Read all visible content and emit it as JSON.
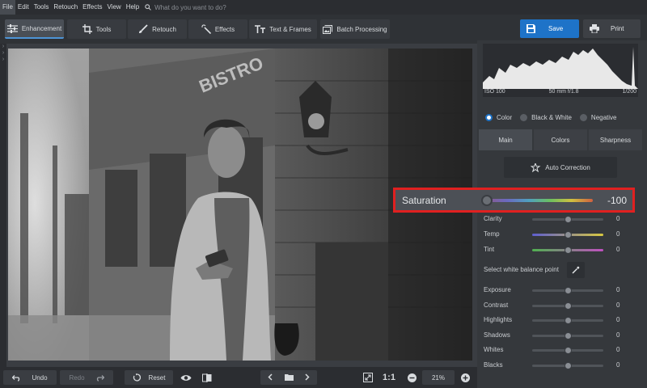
{
  "menu": {
    "items": [
      "File",
      "Edit",
      "Tools",
      "Retouch",
      "Effects",
      "View",
      "Help"
    ],
    "search_placeholder": "What do you want to do?"
  },
  "toolbar": {
    "tabs": [
      {
        "label": "Enhancement",
        "icon": "sliders-icon"
      },
      {
        "label": "Tools",
        "icon": "crop-icon"
      },
      {
        "label": "Retouch",
        "icon": "brush-icon"
      },
      {
        "label": "Effects",
        "icon": "magic-wand-icon"
      },
      {
        "label": "Text & Frames",
        "icon": "text-icon"
      },
      {
        "label": "Batch Processing",
        "icon": "batch-icon"
      }
    ],
    "save_label": "Save",
    "print_label": "Print"
  },
  "histogram": {
    "iso": "ISO 100",
    "lens": "50 mm f/1.8",
    "shutter": "1/200"
  },
  "color_modes": [
    {
      "label": "Color",
      "selected": true
    },
    {
      "label": "Black & White",
      "selected": false
    },
    {
      "label": "Negative",
      "selected": false
    }
  ],
  "subtabs": [
    "Main",
    "Colors",
    "Sharpness"
  ],
  "auto_correction_label": "Auto Correction",
  "saturation": {
    "label": "Saturation",
    "value": "-100",
    "level": 0
  },
  "sliders_a": [
    {
      "label": "Clarity",
      "value": "0",
      "level": 0.5,
      "colors": null
    },
    {
      "label": "Temp",
      "value": "0",
      "level": 0.5,
      "colors": [
        "#5e5ed0",
        "#d8c840"
      ]
    },
    {
      "label": "Tint",
      "value": "0",
      "level": 0.5,
      "colors": [
        "#50b050",
        "#c050c0"
      ]
    }
  ],
  "white_balance_label": "Select white balance point",
  "sliders_b": [
    {
      "label": "Exposure",
      "value": "0",
      "level": 0.5
    },
    {
      "label": "Contrast",
      "value": "0",
      "level": 0.5
    },
    {
      "label": "Highlights",
      "value": "0",
      "level": 0.5
    },
    {
      "label": "Shadows",
      "value": "0",
      "level": 0.5
    },
    {
      "label": "Whites",
      "value": "0",
      "level": 0.5
    },
    {
      "label": "Blacks",
      "value": "0",
      "level": 0.5
    }
  ],
  "bottom": {
    "undo_label": "Undo",
    "redo_label": "Redo",
    "reset_label": "Reset",
    "actual_size_label": "1:1",
    "zoom_value": "21%"
  },
  "photo": {
    "sign_text": "BISTRO"
  }
}
